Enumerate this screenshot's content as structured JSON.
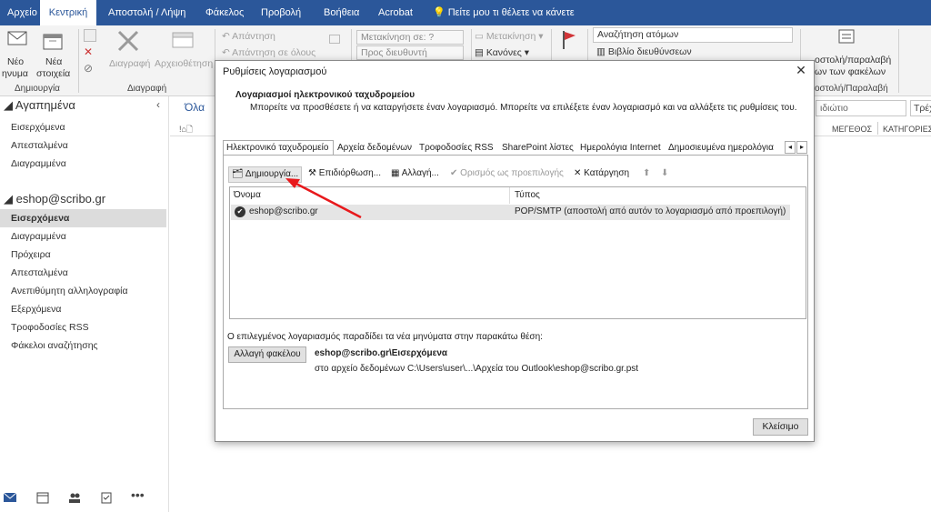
{
  "menu": {
    "tabs": [
      "Αρχείο",
      "Κεντρική",
      "Αποστολή / Λήψη",
      "Φάκελος",
      "Προβολή",
      "Βοήθεια",
      "Acrobat"
    ],
    "tell_me": "Πείτε μου τι θέλετε να κάνετε"
  },
  "ribbon": {
    "new_email_1": "Νέο",
    "new_email_2": "ηνυμα",
    "new_items_1": "Νέα",
    "new_items_2": "στοιχεία",
    "group_new": "Δημιουργία",
    "delete": "Διαγραφή",
    "archive": "Αρχειοθέτηση",
    "group_delete": "Διαγραφή",
    "reply": "Απάντηση",
    "reply_all": "Απάντηση σε όλους",
    "move_to": "Μετακίνηση σε: ?",
    "to_manager": "Προς διευθυντή",
    "move": "Μετακίνηση",
    "rules": "Κανόνες",
    "search_people": "Αναζήτηση ατόμων",
    "address_book": "Βιβλίο διευθύνσεων",
    "send_receive_1": "οστολή/παραλαβή",
    "send_receive_2": "ων των φακέλων",
    "group_send_receive": "οστολή/Παραλαβή"
  },
  "sidebar": {
    "favorites": "Αγαπημένα",
    "fav_items": [
      "Εισερχόμενα",
      "Απεσταλμένα",
      "Διαγραμμένα"
    ],
    "account": "eshop@scribo.gr",
    "account_items": [
      "Εισερχόμενα",
      "Διαγραμμένα",
      "Πρόχειρα",
      "Απεσταλμένα",
      "Ανεπιθύμητη αλληλογραφία",
      "Εξερχόμενα",
      "Τροφοδοσίες RSS",
      "Φάκελοι αναζήτησης"
    ]
  },
  "message_list": {
    "filter_all": "Όλα",
    "search_placeholder": "ιδιώτιο",
    "search_scope": "Τρέχ",
    "col_size": "ΜΕΓΕΘΟΣ",
    "col_categories": "ΚΑΤΗΓΟΡΙΕΣ"
  },
  "dialog": {
    "title": "Ρυθμίσεις λογαριασμού",
    "heading": "Λογαριασμοί ηλεκτρονικού ταχυδρομείου",
    "description": "Μπορείτε να προσθέσετε ή να καταργήσετε έναν λογαριασμό. Μπορείτε να επιλέξετε έναν λογαριασμό και να αλλάξετε τις ρυθμίσεις του.",
    "tabs": [
      "Ηλεκτρονικό ταχυδρομείο",
      "Αρχεία δεδομένων",
      "Τροφοδοσίες RSS",
      "SharePoint λίστες",
      "Ημερολόγια Internet",
      "Δημοσιευμένα ημερολόγια"
    ],
    "toolbar": {
      "new": "Δημιουργία...",
      "repair": "Επιδιόρθωση...",
      "change": "Αλλαγή...",
      "set_default": "Ορισμός ως προεπιλογής",
      "remove": "Κατάργηση"
    },
    "columns": {
      "name": "Όνομα",
      "type": "Τύπος"
    },
    "accounts": [
      {
        "name": "eshop@scribo.gr",
        "type": "POP/SMTP (αποστολή από αυτόν το λογαριασμό από προεπιλογή)"
      }
    ],
    "delivery_info": "Ο επιλεγμένος λογαριασμός παραδίδει τα νέα μηνύματα στην παρακάτω θέση:",
    "change_folder": "Αλλαγή φακέλου",
    "folder_path": "eshop@scribo.gr\\Εισερχόμενα",
    "data_file": "στο αρχείο δεδομένων C:\\Users\\user\\...\\Αρχεία του Outlook\\eshop@scribo.gr.pst",
    "close": "Κλείσιμο"
  },
  "colors": {
    "accent": "#2b579a",
    "annotation_arrow": "#e8191c"
  }
}
